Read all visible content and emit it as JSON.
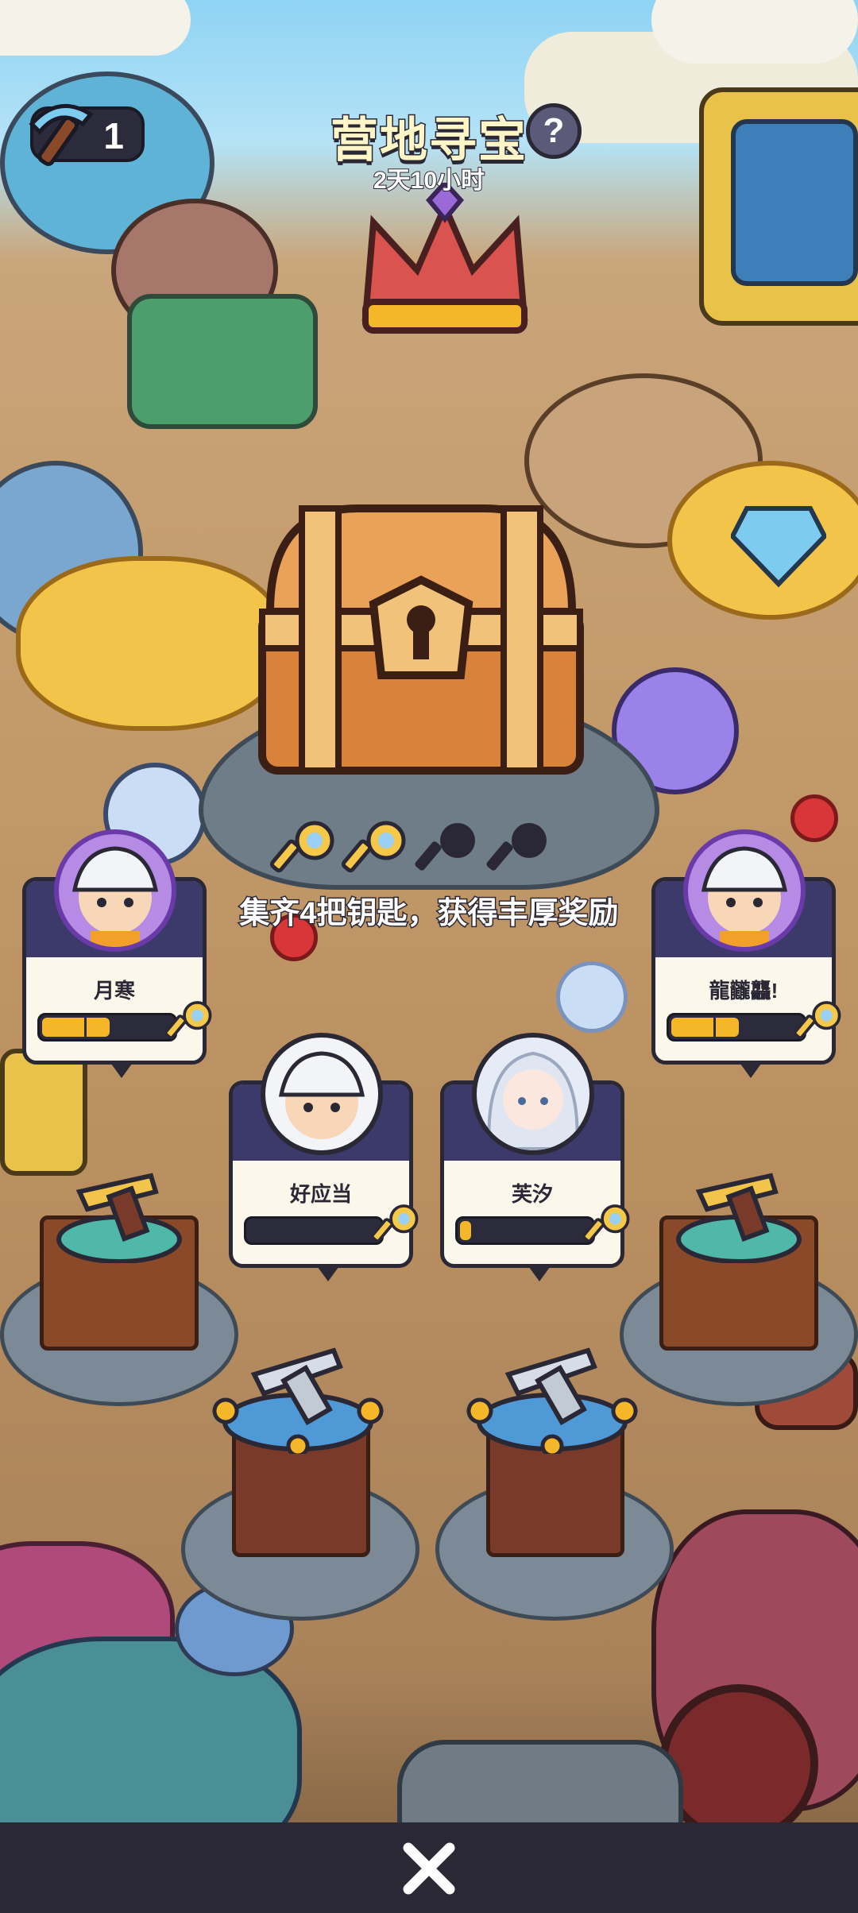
{
  "header": {
    "title": "营地寻宝",
    "help_label": "?",
    "timer": "2天10小时",
    "pickaxe_count": "1"
  },
  "keys": {
    "collected": 2,
    "total": 4,
    "hint": "集齐4把钥匙，获得丰厚奖励"
  },
  "players": [
    {
      "name": "月寒",
      "progress": 0.5
    },
    {
      "name": "好应当",
      "progress": 0.0
    },
    {
      "name": "芙汐",
      "progress": 0.08
    },
    {
      "name": "龍龖龘!",
      "progress": 0.5
    }
  ],
  "footer": {
    "close_icon": "close-icon"
  },
  "colors": {
    "accent": "#f6b62a",
    "dark": "#2b2836",
    "card_header": "#3c3a6a"
  }
}
